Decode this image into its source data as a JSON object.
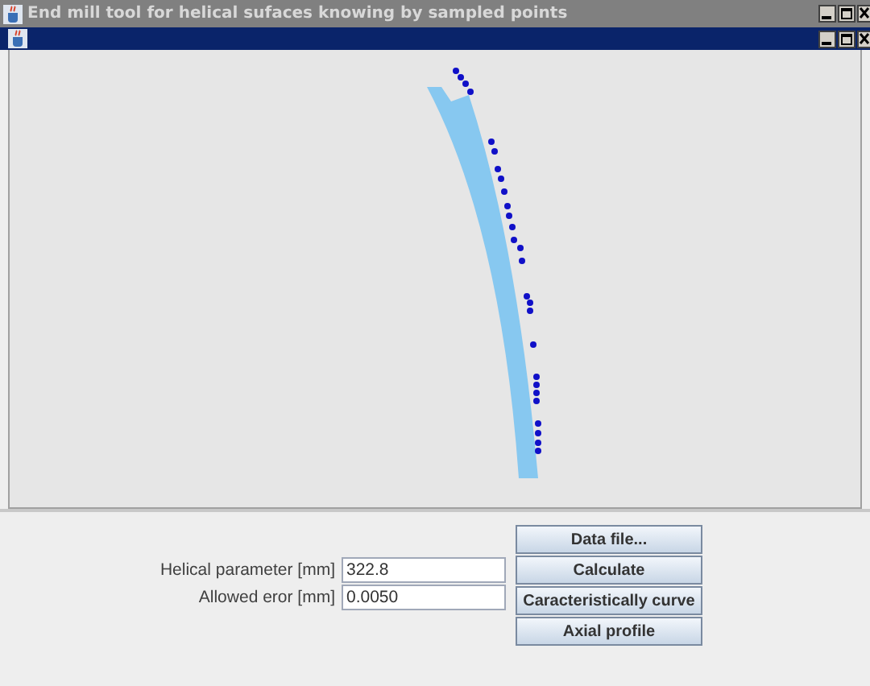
{
  "window": {
    "title": "End mill tool for helical sufaces knowing by sampled points"
  },
  "form": {
    "fields": [
      {
        "label": "Helical parameter [mm]",
        "value": "322.8"
      },
      {
        "label": "Allowed eror [mm]",
        "value": "0.0050"
      }
    ],
    "buttons": [
      "Data file...",
      "Calculate",
      "Caracteristically curve",
      "Axial profile"
    ]
  }
}
